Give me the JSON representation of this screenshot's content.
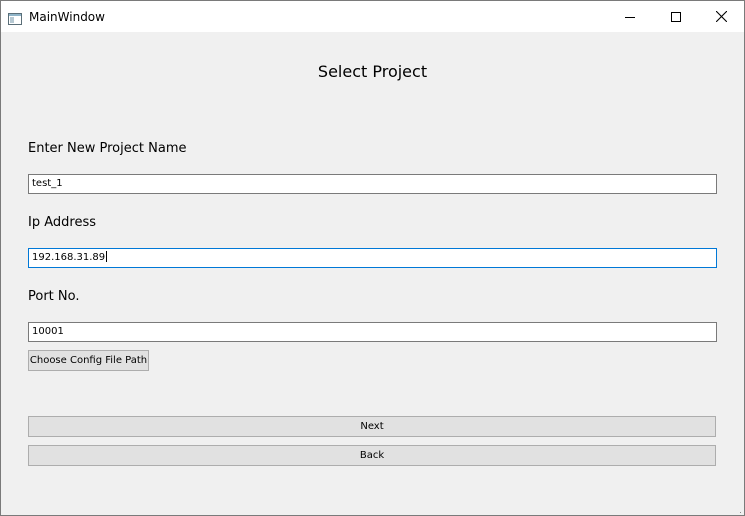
{
  "window": {
    "title": "MainWindow",
    "icons": {
      "app": "app-window-icon",
      "minimize": "minimize-icon",
      "maximize": "maximize-icon",
      "close": "close-icon"
    }
  },
  "page": {
    "title": "Select Project"
  },
  "form": {
    "project_name": {
      "label": "Enter New Project Name",
      "value": "test_1"
    },
    "ip_address": {
      "label": "Ip Address",
      "value": "192.168.31.89"
    },
    "port": {
      "label": "Port No.",
      "value": "10001"
    }
  },
  "buttons": {
    "config_path": "Choose Config File Path",
    "next": "Next",
    "back": "Back"
  },
  "colors": {
    "background": "#f0f0f0",
    "focus_border": "#0078d7",
    "button_face": "#e1e1e1"
  }
}
